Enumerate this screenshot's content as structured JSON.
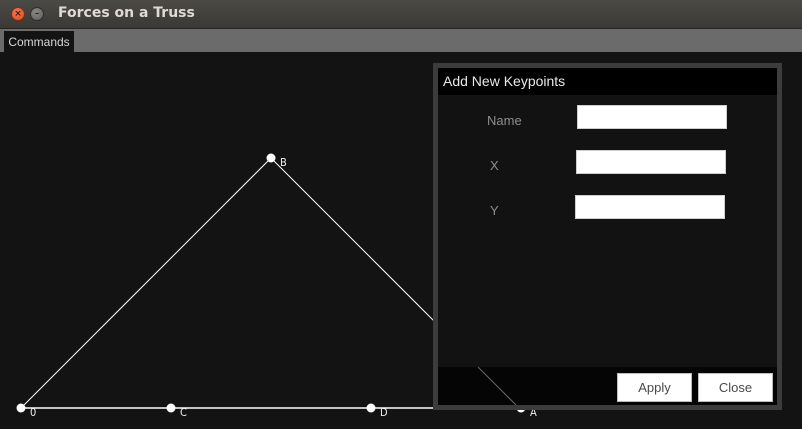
{
  "window": {
    "title": "Forces on a Truss"
  },
  "tabs": [
    {
      "label": "Commands"
    }
  ],
  "truss": {
    "nodes": [
      {
        "name": "0"
      },
      {
        "name": "C"
      },
      {
        "name": "D"
      },
      {
        "name": "A"
      },
      {
        "name": "B"
      }
    ]
  },
  "dialog": {
    "title": "Add New Keypoints",
    "fields": [
      {
        "label": "Name",
        "value": ""
      },
      {
        "label": "X",
        "value": ""
      },
      {
        "label": "Y",
        "value": ""
      }
    ],
    "apply_label": "Apply",
    "close_label": "Close"
  },
  "colors": {
    "background": "#131313",
    "truss_line": "#ffffff",
    "tab_strip": "#6b6b6b",
    "dialog_border": "#3c3c3c"
  }
}
